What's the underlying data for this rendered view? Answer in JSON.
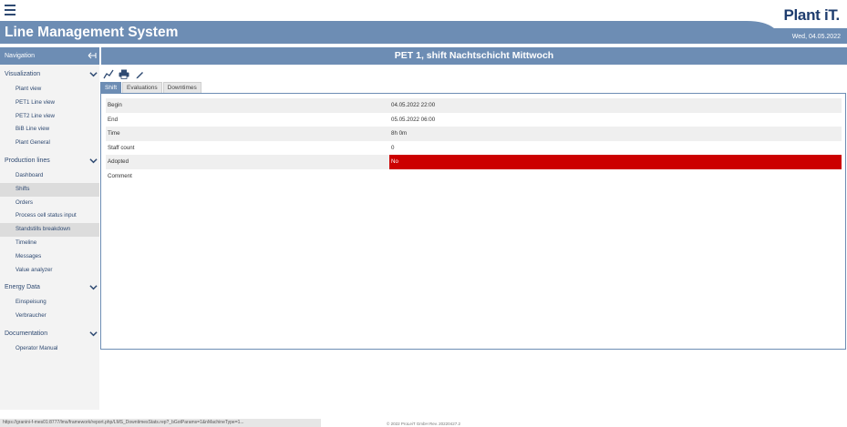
{
  "brand": {
    "name": "Plant iT."
  },
  "header": {
    "title": "Line Management System",
    "date": "Wed, 04.05.2022"
  },
  "sidebar": {
    "title": "Navigation",
    "sections": [
      {
        "label": "Visualization",
        "items": [
          "Plant view",
          "PET1 Line view",
          "PET2 Line view",
          "BiB Line view",
          "Plant General"
        ]
      },
      {
        "label": "Production lines",
        "items": [
          "Dashboard",
          "Shifts",
          "Orders",
          "Process cell status input",
          "Standstills breakdown",
          "Timeline",
          "Messages",
          "Value analyzer"
        ]
      },
      {
        "label": "Energy Data",
        "items": [
          "Einspeisung",
          "Verbraucher"
        ]
      },
      {
        "label": "Documentation",
        "items": [
          "Operator Manual"
        ]
      }
    ]
  },
  "main": {
    "title": "PET 1, shift Nachtschicht Mittwoch",
    "tabs": [
      "Shift",
      "Evaluations",
      "Downtimes"
    ],
    "details": [
      {
        "label": "Begin",
        "value": "04.05.2022 22:00"
      },
      {
        "label": "End",
        "value": "05.05.2022 06:00"
      },
      {
        "label": "Time",
        "value": "8h 0m"
      },
      {
        "label": "Staff count",
        "value": "0"
      },
      {
        "label": "Adopted",
        "value": "No"
      },
      {
        "label": "Comment",
        "value": ""
      }
    ]
  },
  "footer": {
    "status_url": "https://granini-f-mes01:8777/lms/framework/report.php/LMS_DowntimesStats.rep?_bGotParams=1&nMachineType=1...",
    "copyright": "© 2022 ProLeiT GmbH Rev. 20220427.2"
  },
  "colors": {
    "accent": "#6d8db4",
    "brand": "#1e3c6e",
    "alert": "#cc0000"
  }
}
